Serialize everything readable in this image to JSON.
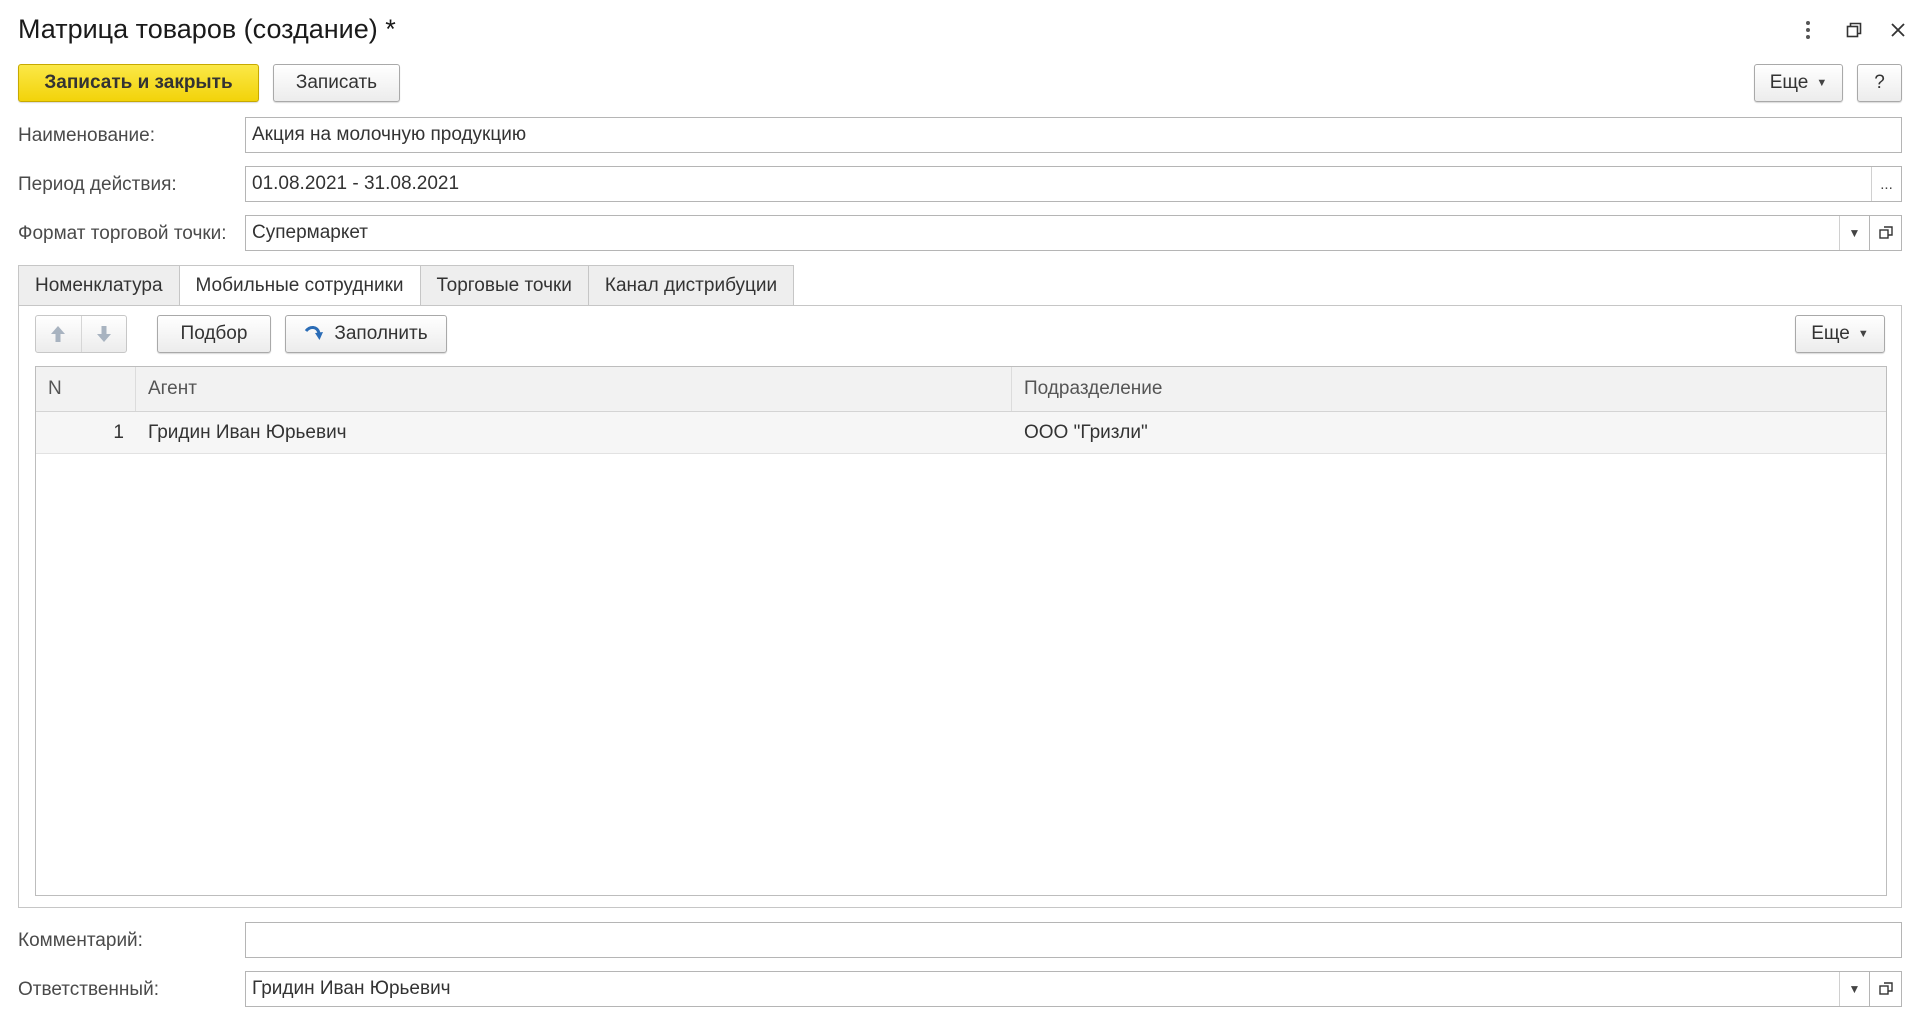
{
  "window": {
    "title": "Матрица товаров (создание) *",
    "menu_icon": "more-vertical-icon",
    "restore_icon": "restore-window-icon",
    "close_icon": "close-icon"
  },
  "toolbar": {
    "save_close_label": "Записать и закрыть",
    "save_label": "Записать",
    "more_label": "Еще",
    "help_label": "?"
  },
  "form": {
    "name_label": "Наименование:",
    "name_value": "Акция на молочную продукцию",
    "period_label": "Период действия:",
    "period_value": "01.08.2021 - 31.08.2021",
    "period_button": "...",
    "format_label": "Формат торговой точки:",
    "format_value": "Супермаркет",
    "comment_label": "Комментарий:",
    "comment_value": "",
    "responsible_label": "Ответственный:",
    "responsible_value": "Гридин Иван Юрьевич"
  },
  "tabs": [
    {
      "label": "Номенклатура",
      "active": false
    },
    {
      "label": "Мобильные сотрудники",
      "active": true
    },
    {
      "label": "Торговые точки",
      "active": false
    },
    {
      "label": "Канал дистрибуции",
      "active": false
    }
  ],
  "panel_toolbar": {
    "pick_label": "Подбор",
    "fill_label": "Заполнить",
    "more_label": "Еще"
  },
  "table": {
    "columns": [
      "N",
      "Агент",
      "Подразделение"
    ],
    "rows": [
      {
        "n": "1",
        "agent": "Гридин Иван Юрьевич",
        "dept": "ООО \"Гризли\""
      }
    ]
  },
  "colors": {
    "primary_button": "#f2d30a",
    "border": "#b5b5b5",
    "row_bg": "#f6f6f6"
  }
}
